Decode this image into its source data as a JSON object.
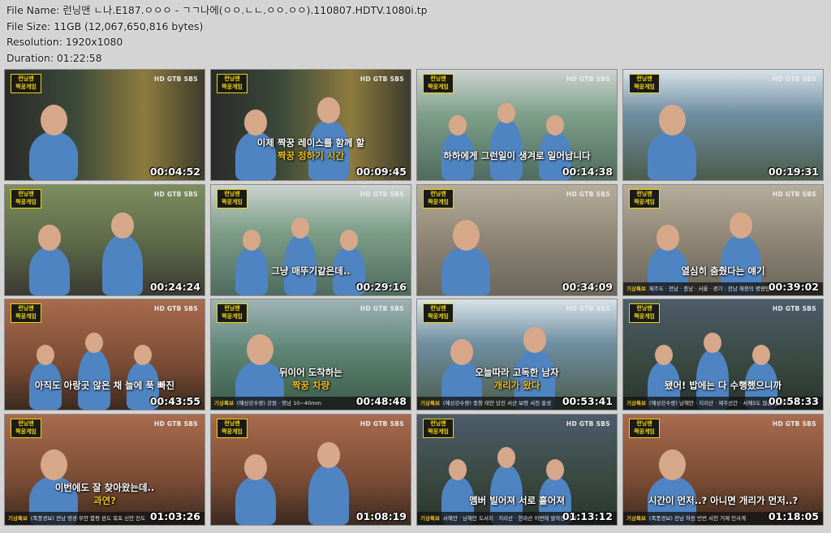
{
  "file_info": {
    "file_name": "File Name: 런닝맨 ㄴ나.E187.ㅇㅇㅇ - ㄱㄱ나에(ㅇㅇ.ㄴㄴ.ㅇㅇ.ㅇㅇ).110807.HDTV.1080i.tp",
    "file_size": "File Size: 11GB (12,067,650,816 bytes)",
    "resolution": "Resolution: 1920x1080",
    "duration": "Duration: 01:22:58"
  },
  "overlay": {
    "logo_top": "런닝맨",
    "logo_bottom": "짝꿍게임",
    "channel": "HD GTB SBS",
    "ticker_prefix": "기상특보"
  },
  "thumbnails": [
    {
      "time": "00:04:52",
      "caption": "",
      "highlight": "",
      "ticker": ""
    },
    {
      "time": "00:09:45",
      "caption": "이제 짝꿍 레이스를 함께 할",
      "highlight": "짝꿍 정하기 시간",
      "ticker": ""
    },
    {
      "time": "00:14:38",
      "caption": "하하에게 그런일이 생겨로 일어납니다",
      "highlight": "",
      "ticker": ""
    },
    {
      "time": "00:19:31",
      "caption": "",
      "highlight": "",
      "ticker": ""
    },
    {
      "time": "00:24:24",
      "caption": "",
      "highlight": "",
      "ticker": ""
    },
    {
      "time": "00:29:16",
      "caption": "그냥 매뚜기같은데..",
      "highlight": "",
      "ticker": ""
    },
    {
      "time": "00:34:09",
      "caption": "",
      "highlight": "",
      "ticker": ""
    },
    {
      "time": "00:39:02",
      "caption": "열심히 춤췄다는 얘기",
      "highlight": "",
      "ticker": "제주도 · 전남 · 충남 · 서울 · 경기 : 전남 해용의 명량면에"
    },
    {
      "time": "00:43:55",
      "caption": "아직도 아랑곳 않은 채 늘에 푹 빠진",
      "highlight": "",
      "ticker": ""
    },
    {
      "time": "00:48:48",
      "caption": "뒤이어 도착하는",
      "highlight": "짝꿍 차량",
      "ticker": "(예상강수량) 강원 · 영남 10~40mm"
    },
    {
      "time": "00:53:41",
      "caption": "오늘따라 고독한 남자",
      "highlight": "개리가 왔다",
      "ticker": "(예상강수량) 충청 태안 당진 서산 보령 서천 홍성"
    },
    {
      "time": "00:58:33",
      "caption": "됐어! 밥에는 다 수행했으니까",
      "highlight": "",
      "ticker": "(예상강수량) 남해안 · 지리산 · 제주산간 · 서해5도 많은 곳 200mm"
    },
    {
      "time": "01:03:26",
      "caption": "이번에도 잘 찾아왔는데..",
      "highlight": "과연?",
      "ticker": "(폭풍경보) 전남 영광 무안 함평 완도 목포 신안 진도"
    },
    {
      "time": "01:08:19",
      "caption": "",
      "highlight": "",
      "ticker": ""
    },
    {
      "time": "01:13:12",
      "caption": "멤버 빌어져 서로 흩어져",
      "highlight": "",
      "ticker": "서해안 · 남해안 도서지 · 지리산 · 한라산 이번에 발하천 대비"
    },
    {
      "time": "01:18:05",
      "caption": "시간이 먼저..? 아니면 개리가 먼저..?",
      "highlight": "",
      "ticker": "(폭풍경보) 전남 하동 빈번 서천 거제 인사계"
    }
  ]
}
